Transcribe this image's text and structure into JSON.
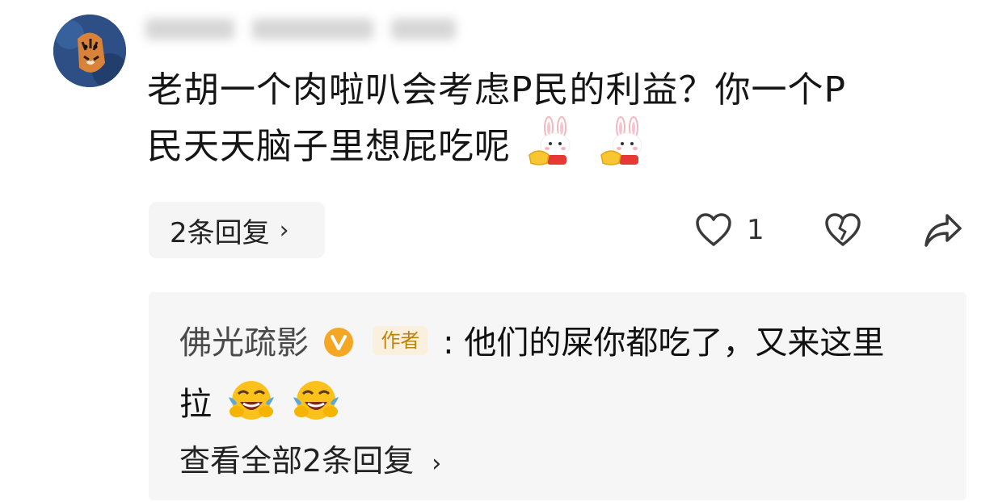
{
  "comment": {
    "username_blurred": true,
    "text_line1": "老胡一个肉啦叭会考虑P民的利益？你一个P",
    "text_line2": "民天天脑子里想屁吃呢",
    "emojis": [
      "rabbit-gold-ingot-emoji",
      "rabbit-gold-ingot-emoji"
    ],
    "replies_label": "2条回复",
    "like_count": "1"
  },
  "reply": {
    "author": "佛光疏影",
    "author_tag": "作者",
    "separator": ":",
    "text_line1": "他们的屎你都吃了，又来这里",
    "text_line2": "拉",
    "emojis": [
      "laughing-tears-emoji",
      "laughing-tears-emoji"
    ],
    "view_all_label": "查看全部2条回复"
  },
  "colors": {
    "reply_bg": "#f6f6f7",
    "chip_bg": "#f5f5f5",
    "verified_badge": "#f5a623",
    "author_tag_text": "#b8860b"
  }
}
